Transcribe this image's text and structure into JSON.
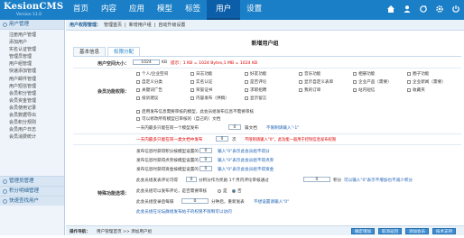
{
  "header": {
    "logo": "KesionCMS",
    "version": "Version 11.0",
    "nav": [
      "首页",
      "内容",
      "应用",
      "模型",
      "标签",
      "用户",
      "设置"
    ],
    "active": "用户"
  },
  "sidebar": {
    "title": "用户管理",
    "items": [
      "注册用户管理",
      "添加用户",
      "实名认证管理",
      "管理员管理",
      "用户组管理",
      "快速添加管理",
      "用户邮件管理",
      "用户短信管理",
      "会员积分管理",
      "会员资金管理",
      "会员使用记录",
      "会员数据导出",
      "会员积分规则",
      "会员用户日志",
      "会员消费统计"
    ],
    "groups": [
      "管理员管理",
      "积分明细管理",
      "快速查找用户"
    ]
  },
  "breadcrumb": {
    "label": "用户权限管理：",
    "items": [
      "管理首页",
      "新增用户组",
      "自动升级设置"
    ]
  },
  "page_title": "新增用户组",
  "tabs": [
    "基本信息",
    "权限分配"
  ],
  "form": {
    "space_label": "用户空间大小：",
    "space_value": "1024",
    "space_hint": "提示：1 KB = 1024 Bytes,1 MB = 1024 KB",
    "func_label": "会员功能权限：",
    "perms": [
      "个人/企业空间",
      "日志功能",
      "好友功能",
      "音乐功能",
      "相册功能",
      "圈子功能",
      "自定义分类",
      "实名认证",
      "是否评论",
      "显示自定义表单",
      "企业产品（需要）",
      "企业新闻（需要）",
      "关键词广告",
      "荣誉证书",
      "求职招聘",
      "我的订单",
      "站内短信",
      "收藏夹",
      "投诉建议",
      "内容发布（供稿）",
      "显示留言"
    ],
    "check1": "启用发布信息需要审核的模型，此会员组发布信息不需要审核",
    "check2": "可以修改所有模型已审核的（自己的）文档",
    "days_label": "一天内最多只能在同一个模型发布",
    "days_value": "0",
    "days_unit": "篇文档",
    "days_hint": "不限制请输入\"-1\"",
    "note": "一天内最多只能在同一类文档中发布",
    "note_value": "0",
    "note_unit": "次",
    "note_hint": "不限制请输入\"0\"，此功能一般用于控制信息发布权限",
    "spec_label": "特殊功能选项：",
    "rows": [
      {
        "text": "发布信息时获得积分按模型设置的",
        "value": "0",
        "hint": "输入\"0\"表示此会员组不得分"
      },
      {
        "text": "发布信息时获得点券按模型设置的",
        "value": "0",
        "hint": "输入\"0\"表示此会员组不得点券"
      },
      {
        "text": "发布信息时获得资金按模型设置的",
        "value": "0",
        "hint": "输入\"0\"表示此会员组不得资金"
      }
    ],
    "row4": {
      "text": "此会员组发表评论可得",
      "value": "0",
      "mid": "分积分作为奖励 1个月内评论审核通过",
      "value2": "0",
      "end": "积分",
      "hint": "可以输入\"0\"表示不增加也不减少积分"
    },
    "row5": {
      "text": "此会员组可以发布评论，是否需要审核",
      "yes": "是",
      "no": "否"
    },
    "row6": {
      "text": "此会员组登录后每隔",
      "value": "0",
      "mid": "分钟后，重新发表",
      "hint": "不想设置请输入\"0\""
    },
    "row7": "此会员组在论坛群组发布帖子的权限不限制可以访问"
  },
  "bottom": {
    "label": "操作导航：",
    "path": "用户管理首页 >> 添加用户组",
    "buttons": [
      "确定增加",
      "取消返回",
      "添加会员",
      "技术支持"
    ]
  }
}
